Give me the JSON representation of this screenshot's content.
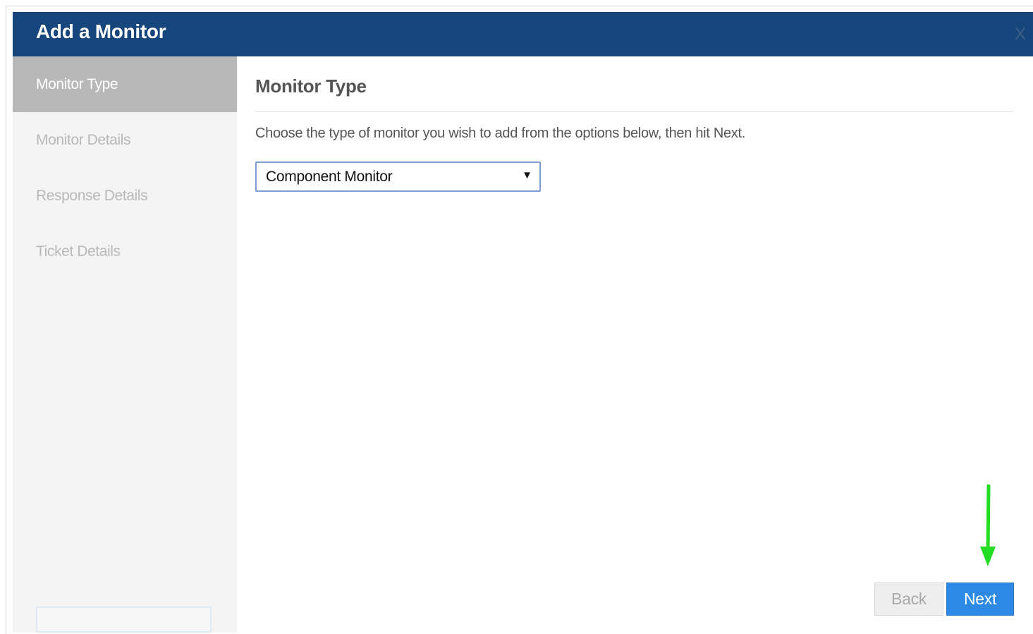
{
  "dialog": {
    "title": "Add a Monitor",
    "close_label": "X"
  },
  "sidebar": {
    "steps": [
      {
        "label": "Monitor Type",
        "active": true
      },
      {
        "label": "Monitor Details",
        "active": false
      },
      {
        "label": "Response Details",
        "active": false
      },
      {
        "label": "Ticket Details",
        "active": false
      }
    ]
  },
  "content": {
    "title": "Monitor Type",
    "instructions": "Choose the type of monitor you wish to add from the options below, then hit Next.",
    "monitor_type_select": {
      "selected": "Component Monitor"
    }
  },
  "footer": {
    "back_label": "Back",
    "next_label": "Next"
  },
  "annotation": {
    "arrow_color": "#22dd22",
    "arrow_icon": "down-arrow-icon"
  },
  "colors": {
    "header_bg": "#17467c",
    "active_step_bg": "#b8b8b8",
    "next_button": "#2c8ae4"
  }
}
